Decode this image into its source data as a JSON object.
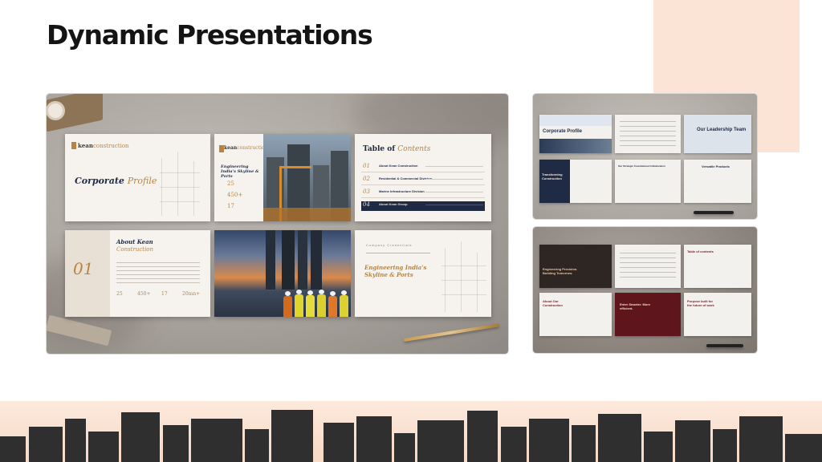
{
  "page": {
    "title": "Dynamic Presentations"
  },
  "main_mockup": {
    "slide_corporate": {
      "brand_main": "kean",
      "brand_sub": "construction",
      "title_main": "Corporate",
      "title_accent": "Profile"
    },
    "slide_skyline": {
      "brand_main": "kean",
      "brand_sub": "construction",
      "title": "Engineering India's Skyline & Ports",
      "stat1": "25",
      "stat2": "450+",
      "stat3": "17"
    },
    "slide_toc": {
      "title_main": "Table of",
      "title_accent": "Contents",
      "items": [
        {
          "num": "01",
          "label": "About Kean Construction"
        },
        {
          "num": "02",
          "label": "Residential & Commercial Division"
        },
        {
          "num": "03",
          "label": "Marine Infrastructure Division"
        },
        {
          "num": "04",
          "label": "About Kean Group"
        }
      ]
    },
    "slide_about": {
      "title_main": "About Kean",
      "title_accent": "Construction",
      "big_num": "01",
      "stat1": "25",
      "stat2": "450+",
      "stat3": "17",
      "stat4": "20mn+"
    },
    "slide_closing": {
      "eyebrow": "Company Credentials",
      "title": "Engineering India's Skyline & Ports"
    }
  },
  "top_mockup": {
    "cover": "Corporate Profile",
    "leadership": "Our Leadership Team",
    "transforming": "Transforming Construction",
    "approach": "Our Strategic Foundational Collaboration",
    "products": "Versatile Products"
  },
  "bottom_mockup": {
    "cover": "Engineering Precision. Building Tomorrow.",
    "toc": "Table of contents",
    "about": "About Our Construction",
    "reach": "Enter Smarter. More efficient.",
    "purpose": "Purpose built for the future of work"
  },
  "colors": {
    "peach": "#fbe3d6",
    "navy": "#1f2a44",
    "gold": "#b8843f",
    "skyline": "#2f2f2f"
  }
}
